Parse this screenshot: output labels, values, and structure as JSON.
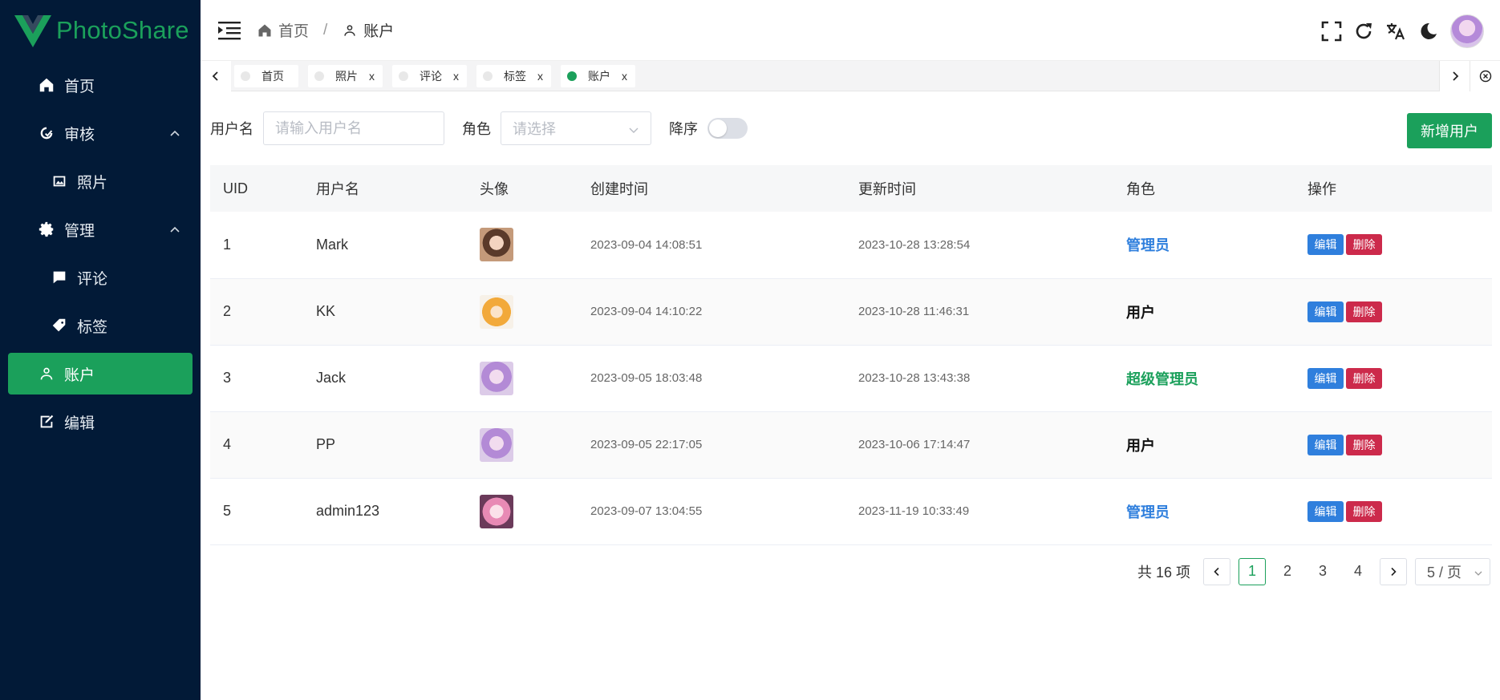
{
  "app": {
    "name": "PhotoShare"
  },
  "colors": {
    "brand": "#1ba05b",
    "sidebar_bg": "#021a37",
    "edit": "#2f7fdd",
    "delete": "#cc2a4b",
    "admin": "#2f7fdd",
    "superadmin": "#1ba05b"
  },
  "sidebar": {
    "items": [
      {
        "label": "首页",
        "icon": "home-icon"
      },
      {
        "label": "审核",
        "icon": "audit-icon",
        "expanded": true
      },
      {
        "label": "照片",
        "icon": "image-icon"
      },
      {
        "label": "管理",
        "icon": "gear-icon",
        "expanded": true
      },
      {
        "label": "评论",
        "icon": "comment-icon"
      },
      {
        "label": "标签",
        "icon": "tag-icon"
      },
      {
        "label": "账户",
        "icon": "user-icon",
        "active": true
      },
      {
        "label": "编辑",
        "icon": "edit-icon"
      }
    ]
  },
  "header": {
    "breadcrumbs": [
      {
        "label": "首页",
        "icon": "home-icon"
      },
      {
        "label": "账户",
        "icon": "user-icon"
      }
    ],
    "separator": "/"
  },
  "tabs": [
    {
      "label": "首页"
    },
    {
      "label": "照片",
      "close": "x"
    },
    {
      "label": "评论",
      "close": "x"
    },
    {
      "label": "标签",
      "close": "x"
    },
    {
      "label": "账户",
      "close": "x",
      "active": true
    }
  ],
  "filter": {
    "username_label": "用户名",
    "username_placeholder": "请输入用户名",
    "role_label": "角色",
    "role_placeholder": "请选择",
    "desc_label": "降序",
    "desc_on": false,
    "add_button": "新增用户"
  },
  "table": {
    "columns": [
      "UID",
      "用户名",
      "头像",
      "创建时间",
      "更新时间",
      "角色",
      "操作"
    ],
    "edit_label": "编辑",
    "delete_label": "删除",
    "rows": [
      {
        "uid": "1",
        "username": "Mark",
        "created": "2023-09-04 14:08:51",
        "updated": "2023-10-28 13:28:54",
        "role": "管理员",
        "role_color": "#2f7fdd"
      },
      {
        "uid": "2",
        "username": "KK",
        "created": "2023-09-04 14:10:22",
        "updated": "2023-10-28 11:46:31",
        "role": "用户",
        "role_color": "#111111"
      },
      {
        "uid": "3",
        "username": "Jack",
        "created": "2023-09-05 18:03:48",
        "updated": "2023-10-28 13:43:38",
        "role": "超级管理员",
        "role_color": "#1ba05b"
      },
      {
        "uid": "4",
        "username": "PP",
        "created": "2023-09-05 22:17:05",
        "updated": "2023-10-06 17:14:47",
        "role": "用户",
        "role_color": "#111111"
      },
      {
        "uid": "5",
        "username": "admin123",
        "created": "2023-09-07 13:04:55",
        "updated": "2023-11-19 10:33:49",
        "role": "管理员",
        "role_color": "#2f7fdd"
      }
    ]
  },
  "pagination": {
    "total": "共 16 项",
    "pages": [
      "1",
      "2",
      "3",
      "4"
    ],
    "current": "1",
    "page_size": "5 / 页"
  }
}
